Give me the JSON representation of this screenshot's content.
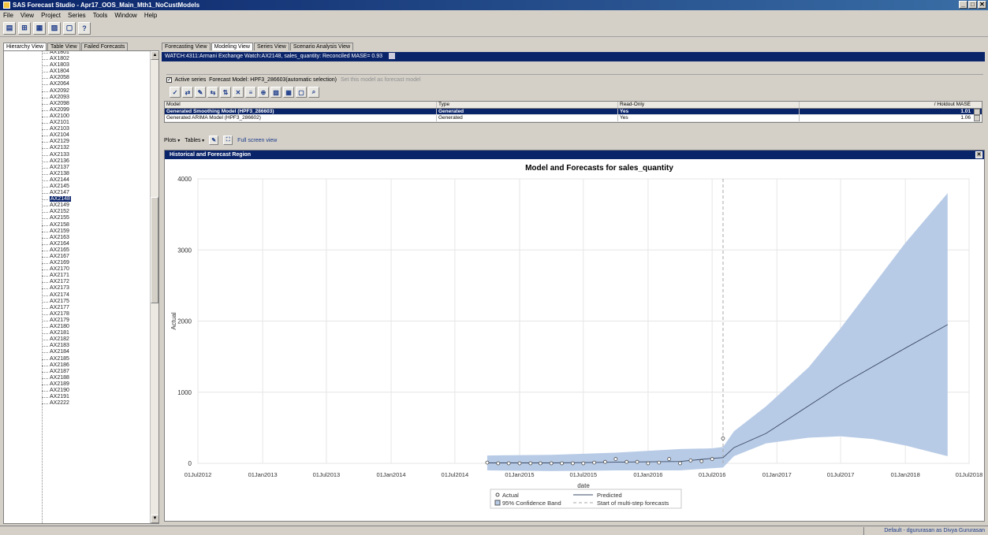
{
  "window": {
    "title": "SAS Forecast Studio - Apr17_OOS_Main_Mth1_NoCustModels",
    "controls": [
      "_",
      "□",
      "✕"
    ]
  },
  "menu": [
    "File",
    "View",
    "Project",
    "Series",
    "Tools",
    "Window",
    "Help"
  ],
  "toolbar": {
    "buttons": [
      {
        "icon": "project-icon",
        "glyph": "▤"
      },
      {
        "icon": "hierarchy-icon",
        "glyph": "⊞"
      },
      {
        "icon": "table-icon",
        "glyph": "▦"
      },
      {
        "icon": "chart-icon",
        "glyph": "▨"
      },
      {
        "icon": "print-icon",
        "glyph": "▢"
      },
      {
        "icon": "help-icon",
        "glyph": "?"
      }
    ]
  },
  "left_tabs": [
    "Hierarchy View",
    "Table View",
    "Failed Forecasts"
  ],
  "tree": {
    "items": [
      "AX1801",
      "AX1802",
      "AX1803",
      "AX1804",
      "AX2058",
      "AX2064",
      "AX2092",
      "AX2093",
      "AX2098",
      "AX2099",
      "AX2100",
      "AX2101",
      "AX2103",
      "AX2104",
      "AX2129",
      "AX2132",
      "AX2133",
      "AX2136",
      "AX2137",
      "AX2138",
      "AX2144",
      "AX2145",
      "AX2147",
      "AX2148",
      "AX2149",
      "AX2152",
      "AX2155",
      "AX2158",
      "AX2159",
      "AX2163",
      "AX2164",
      "AX2165",
      "AX2167",
      "AX2169",
      "AX2170",
      "AX2171",
      "AX2172",
      "AX2173",
      "AX2174",
      "AX2175",
      "AX2177",
      "AX2178",
      "AX2179",
      "AX2180",
      "AX2181",
      "AX2182",
      "AX2183",
      "AX2184",
      "AX2185",
      "AX2186",
      "AX2187",
      "AX2188",
      "AX2189",
      "AX2190",
      "AX2191",
      "AX2222"
    ],
    "selected": "AX2148"
  },
  "right_tabs": [
    "Forecasting View",
    "Modeling View",
    "Series View",
    "Scenario Analysis View"
  ],
  "active_right_tab": "Modeling View",
  "watch_text": "WATCH:4311:Armani Exchange Watch:AX2148, sales_quantity: Reconciled MASE= 0.93",
  "active_series": {
    "label": "Active series",
    "model_text": "Forecast Model: HPF3_286603(automatic selection)",
    "set_link": "Set this model as forecast model"
  },
  "model_toolbar": [
    "✓",
    "⇄",
    "✎",
    "⇆",
    "⇅",
    "✕",
    "≡",
    "⊕",
    "▨",
    "▦",
    "▢",
    "⌕"
  ],
  "model_table": {
    "headers": [
      "Model",
      "Type",
      "Read-Only",
      "/ Holdout MASE"
    ],
    "rows": [
      {
        "model": "Generated Smoothing Model (HPF3_286603)",
        "type": "Generated",
        "readonly": "Yes",
        "mase": "1.01"
      },
      {
        "model": "Generated ARIMA Model (HPF3_286602)",
        "type": "Generated",
        "readonly": "Yes",
        "mase": "1.06"
      }
    ]
  },
  "plots_bar": {
    "plots": "Plots",
    "tables": "Tables",
    "fullscreen": "Full screen view"
  },
  "plot_panel_title": "Historical and Forecast Region",
  "colors": {
    "band": "#b8cbe6",
    "predicted": "#3b4a66",
    "actual": "#4a4a4a",
    "ref_line": "#a8a8a8",
    "titlebar": "#0a246a"
  },
  "chart_data": {
    "type": "line",
    "title": "Model and Forecasts for sales_quantity",
    "xlabel": "date",
    "ylabel": "Actual",
    "ylim": [
      0,
      4000
    ],
    "yticks": [
      0,
      1000,
      2000,
      3000,
      4000
    ],
    "xlim": [
      "2012-07-01",
      "2018-07-01"
    ],
    "xticks": [
      "01Jul2012",
      "01Jan2013",
      "01Jul2013",
      "01Jan2014",
      "01Jul2014",
      "01Jan2015",
      "01Jul2015",
      "01Jan2016",
      "01Jul2016",
      "01Jan2017",
      "01Jul2017",
      "01Jan2018",
      "01Jul2018"
    ],
    "grid": true,
    "legend": {
      "position": "bottom",
      "entries": [
        "Actual",
        "Predicted",
        "95% Confidence Band",
        "Start of multi-step forecasts"
      ]
    },
    "forecast_start": "2016-08-01",
    "actual": {
      "x": [
        "2014-10-01",
        "2014-11-01",
        "2014-12-01",
        "2015-01-01",
        "2015-02-01",
        "2015-03-01",
        "2015-04-01",
        "2015-05-01",
        "2015-06-01",
        "2015-07-01",
        "2015-08-01",
        "2015-09-01",
        "2015-10-01",
        "2015-11-01",
        "2015-12-01",
        "2016-01-01",
        "2016-02-01",
        "2016-03-01",
        "2016-04-01",
        "2016-05-01",
        "2016-06-01",
        "2016-07-01",
        "2016-08-01"
      ],
      "y": [
        10,
        0,
        0,
        0,
        0,
        0,
        0,
        0,
        0,
        0,
        10,
        20,
        60,
        20,
        20,
        0,
        10,
        60,
        0,
        40,
        30,
        60,
        350
      ]
    },
    "predicted": {
      "x": [
        "2014-10-01",
        "2015-04-01",
        "2015-10-01",
        "2016-04-01",
        "2016-07-01",
        "2016-08-01",
        "2016-09-01",
        "2016-12-01",
        "2017-07-01",
        "2018-01-01",
        "2018-05-01"
      ],
      "y": [
        5,
        5,
        15,
        25,
        70,
        80,
        220,
        420,
        1100,
        1620,
        1950
      ]
    },
    "band_upper": {
      "x": [
        "2014-10-01",
        "2015-04-01",
        "2015-10-01",
        "2016-04-01",
        "2016-07-01",
        "2016-08-01",
        "2016-09-01",
        "2016-12-01",
        "2017-04-01",
        "2017-07-01",
        "2017-10-01",
        "2018-01-01",
        "2018-05-01"
      ],
      "y": [
        110,
        120,
        150,
        200,
        210,
        230,
        450,
        800,
        1350,
        1900,
        2500,
        3100,
        3800
      ]
    },
    "band_lower": {
      "x": [
        "2014-10-01",
        "2015-04-01",
        "2015-10-01",
        "2016-04-01",
        "2016-07-01",
        "2016-08-01",
        "2016-09-01",
        "2016-12-01",
        "2017-04-01",
        "2017-07-01",
        "2017-10-01",
        "2018-01-01",
        "2018-05-01"
      ],
      "y": [
        -100,
        -110,
        -100,
        -100,
        -70,
        -60,
        100,
        280,
        360,
        380,
        340,
        250,
        100
      ]
    }
  },
  "status": {
    "user": "Default - dgururasan as Divya Gururasan"
  }
}
